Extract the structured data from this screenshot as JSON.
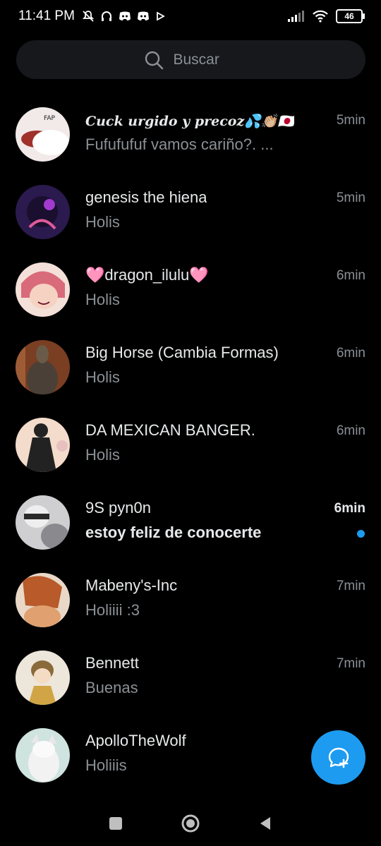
{
  "status_bar": {
    "time": "11:41 PM",
    "battery": "46",
    "icons_left": [
      "mute-icon",
      "headphones-icon",
      "discord-icon",
      "discord-icon",
      "play-icon"
    ],
    "icons_right": [
      "signal-icon",
      "wifi-icon",
      "battery-icon"
    ]
  },
  "search": {
    "placeholder": "Buscar"
  },
  "conversations": [
    {
      "name": "Cuck urgido y precoz💦👏🏼🇯🇵",
      "message": "Fufufufuf vamos cariño?. ...",
      "time": "5min",
      "unread": false,
      "avatar_colors": [
        "#f2e9e9",
        "#a0302a"
      ]
    },
    {
      "name": "genesis the hiena",
      "message": "Holis",
      "time": "5min",
      "unread": false,
      "avatar_colors": [
        "#2b1a4e",
        "#a23ad0"
      ]
    },
    {
      "name": "🩷dragon_ilulu🩷",
      "message": "Holis",
      "time": "6min",
      "unread": false,
      "avatar_colors": [
        "#f0c9c0",
        "#d96a7a"
      ]
    },
    {
      "name": "Big Horse (Cambia Formas)",
      "message": "Holis",
      "time": "6min",
      "unread": false,
      "avatar_colors": [
        "#6b3a24",
        "#c27a4a"
      ]
    },
    {
      "name": "DA MEXICAN BANGER.",
      "message": "Holis",
      "time": "6min",
      "unread": false,
      "avatar_colors": [
        "#f3dccb",
        "#222222"
      ]
    },
    {
      "name": "9S pyn0n",
      "message": "estoy feliz de conocerte",
      "time": "6min",
      "unread": true,
      "avatar_colors": [
        "#cfcfd2",
        "#3c3c3c"
      ]
    },
    {
      "name": "Mabeny's-Inc",
      "message": "Holiiii :3",
      "time": "7min",
      "unread": false,
      "avatar_colors": [
        "#8a4a2a",
        "#e0a070"
      ]
    },
    {
      "name": "Bennett",
      "message": "Buenas",
      "time": "7min",
      "unread": false,
      "avatar_colors": [
        "#ede6da",
        "#d1a545"
      ]
    },
    {
      "name": "ApolloTheWolf",
      "message": "Holiiis",
      "time": "",
      "unread": false,
      "avatar_colors": [
        "#cfe3df",
        "#8aa8b0"
      ]
    }
  ],
  "fab": {
    "icon": "new-message-icon"
  },
  "nav": {
    "icons": [
      "recents-icon",
      "home-icon",
      "back-icon"
    ]
  },
  "colors": {
    "accent": "#1d9bf0",
    "background": "#000000",
    "muted": "#8b9095"
  }
}
